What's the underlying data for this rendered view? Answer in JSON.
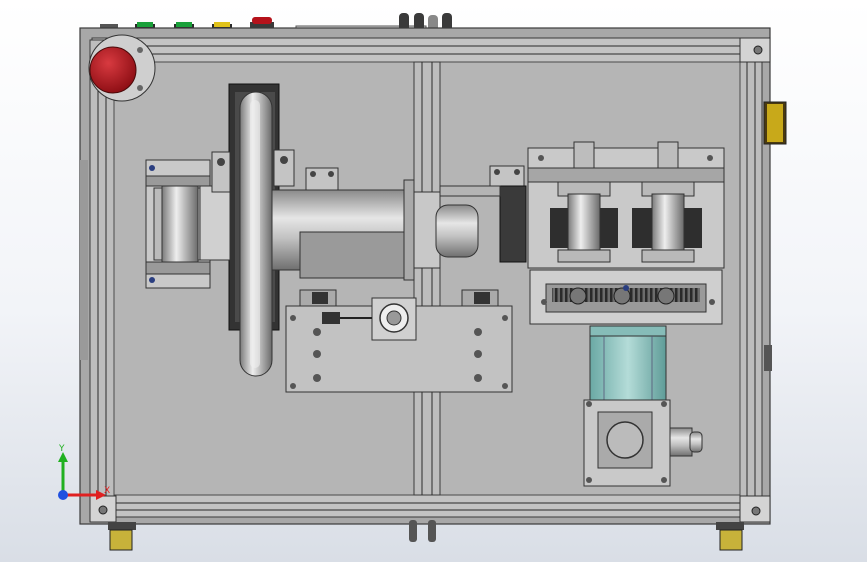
{
  "view": {
    "triad": {
      "x_label": "X",
      "y_label": "Y"
    }
  },
  "colors": {
    "frame": "#a8a8a8",
    "panel": "#b5b5b5",
    "motor_body": "#bcc8d2",
    "gear_motor": "#98c4c0",
    "emergency_stop": "#b5121b",
    "pilot_green": "#1aa03a",
    "pilot_yellow": "#e0c21a",
    "caster_wheel": "#c7b23a",
    "axis_x": "#e02020",
    "axis_y": "#20b020",
    "axis_z": "#2050e0"
  },
  "icons": {
    "emergency_stop": "emergency-stop-icon",
    "coordinate_triad": "coordinate-triad-icon"
  }
}
